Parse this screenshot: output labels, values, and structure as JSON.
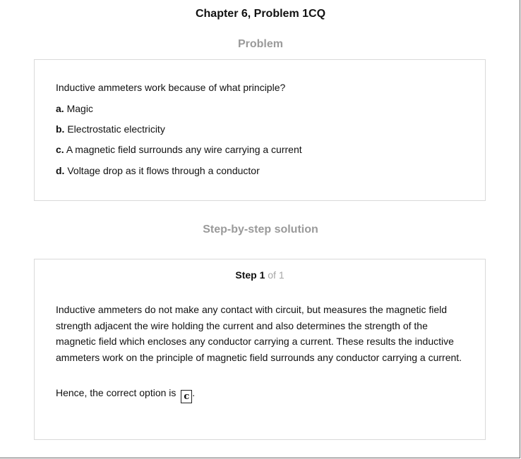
{
  "header": {
    "chapter_title": "Chapter 6, Problem 1CQ"
  },
  "problem": {
    "heading": "Problem",
    "question": "Inductive ammeters work because of what principle?",
    "options": [
      {
        "letter": "a.",
        "text": "Magic"
      },
      {
        "letter": "b.",
        "text": "Electrostatic electricity"
      },
      {
        "letter": "c.",
        "text": "A magnetic field surrounds any wire carrying a current"
      },
      {
        "letter": "d.",
        "text": "Voltage drop as it flows through a conductor"
      }
    ]
  },
  "solution": {
    "heading": "Step-by-step solution",
    "step_label": "Step 1",
    "step_of": "of 1",
    "explanation": "Inductive ammeters do not make any contact with circuit, but measures the magnetic field strength adjacent the wire holding the current and also determines the strength of the magnetic field which encloses any conductor carrying a current. These results the inductive ammeters work on the principle of magnetic field surrounds any conductor carrying a current.",
    "conclusion_prefix": "Hence, the correct option is",
    "answer": "c",
    "conclusion_suffix": "."
  }
}
